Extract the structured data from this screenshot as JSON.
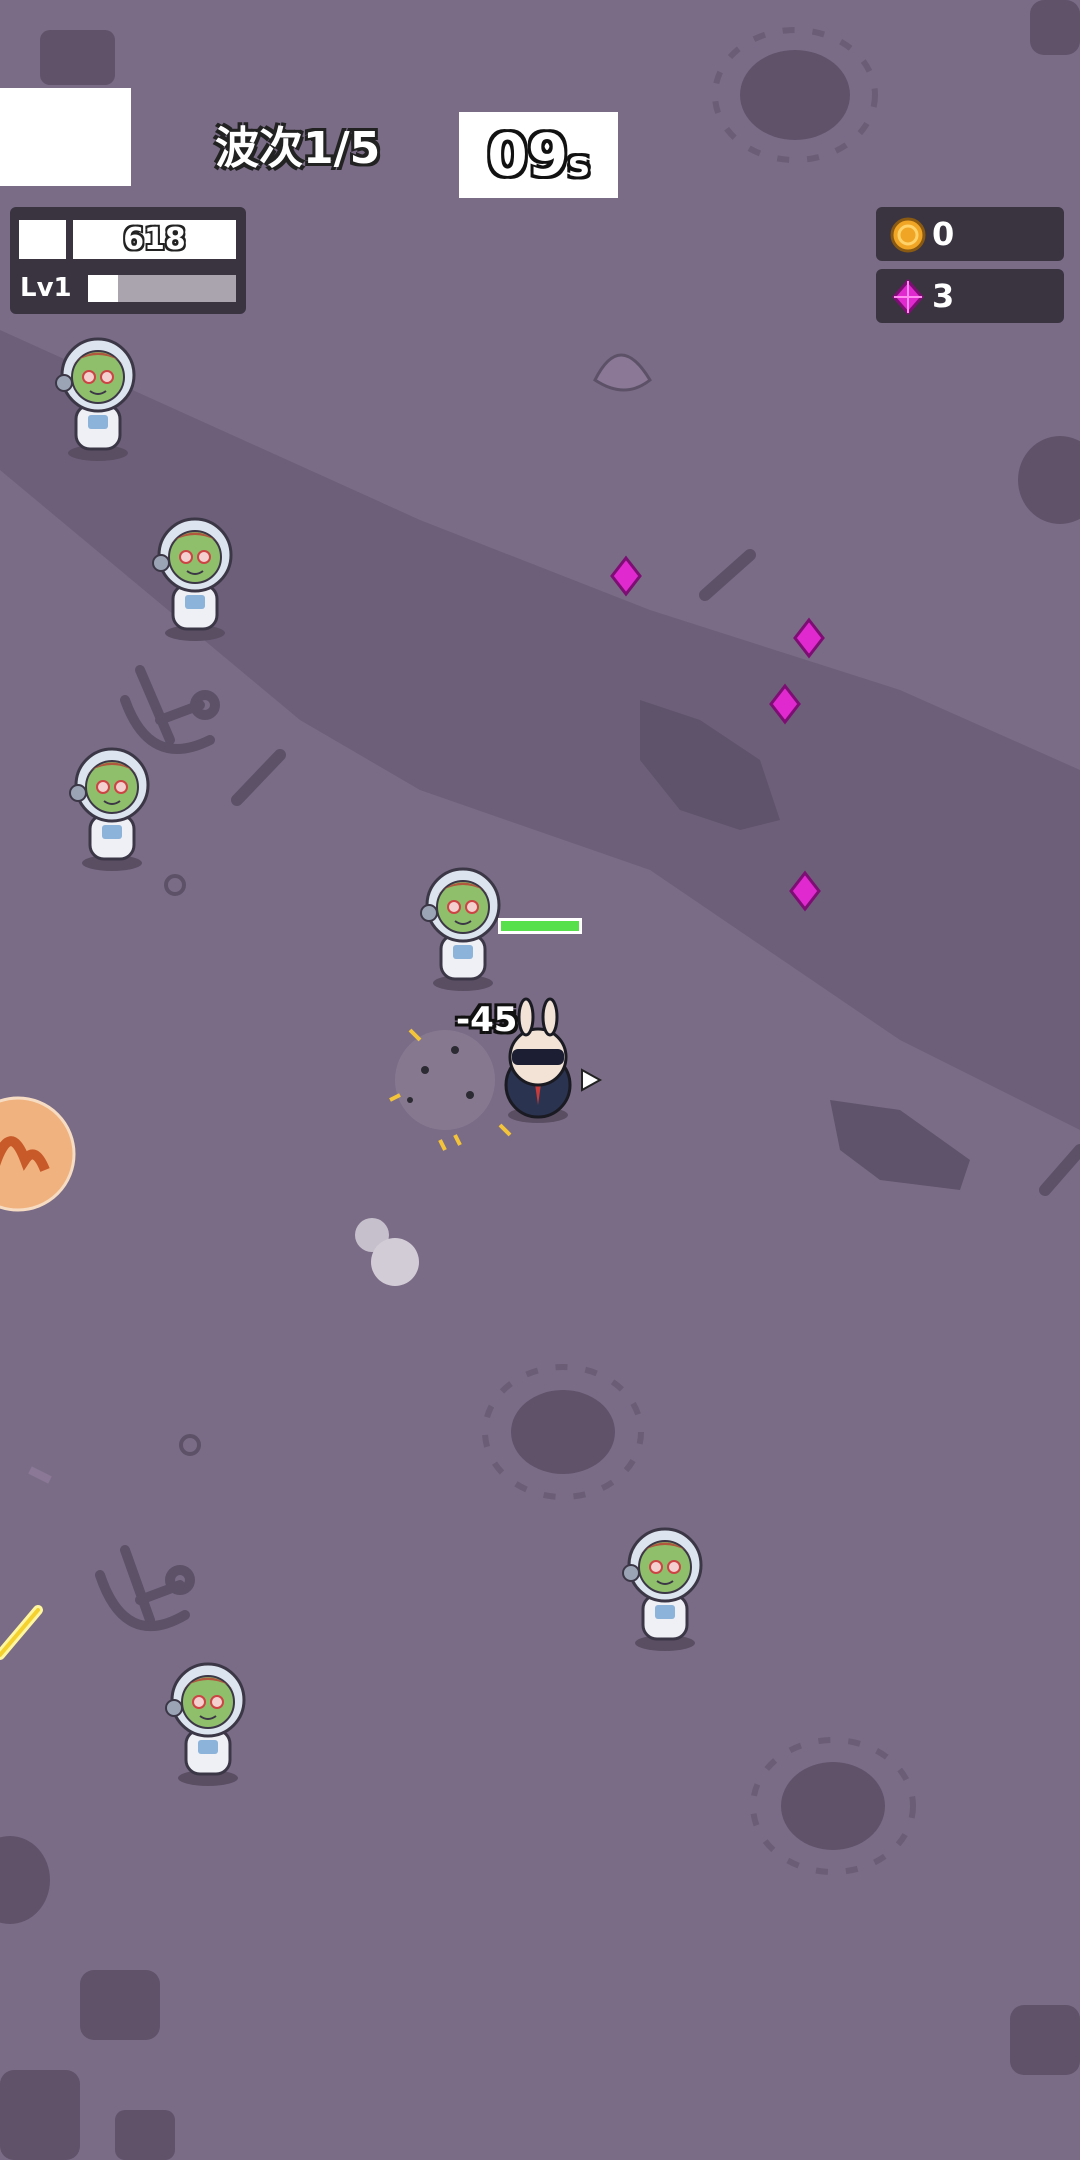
{
  "hud": {
    "wave_label": "波次1/5",
    "timer_value": "09",
    "timer_unit": "s",
    "player_hp": "618",
    "level_label": "Lv1",
    "xp_progress": 0.2,
    "coins": "0",
    "gems": "3"
  },
  "combat": {
    "damage_text": "-45",
    "enemy_health_fraction": 1.0
  },
  "colors": {
    "ground": "#7a6c86",
    "road": "#6e607a",
    "hud_panel": "#3a3441",
    "gem": "#e02ad0",
    "coin": "#f0a524",
    "zombie_skin": "#8fbf6b"
  },
  "icons": [
    "coin-icon",
    "gem-icon",
    "skill-orb-icon",
    "aim-arrow-icon"
  ]
}
